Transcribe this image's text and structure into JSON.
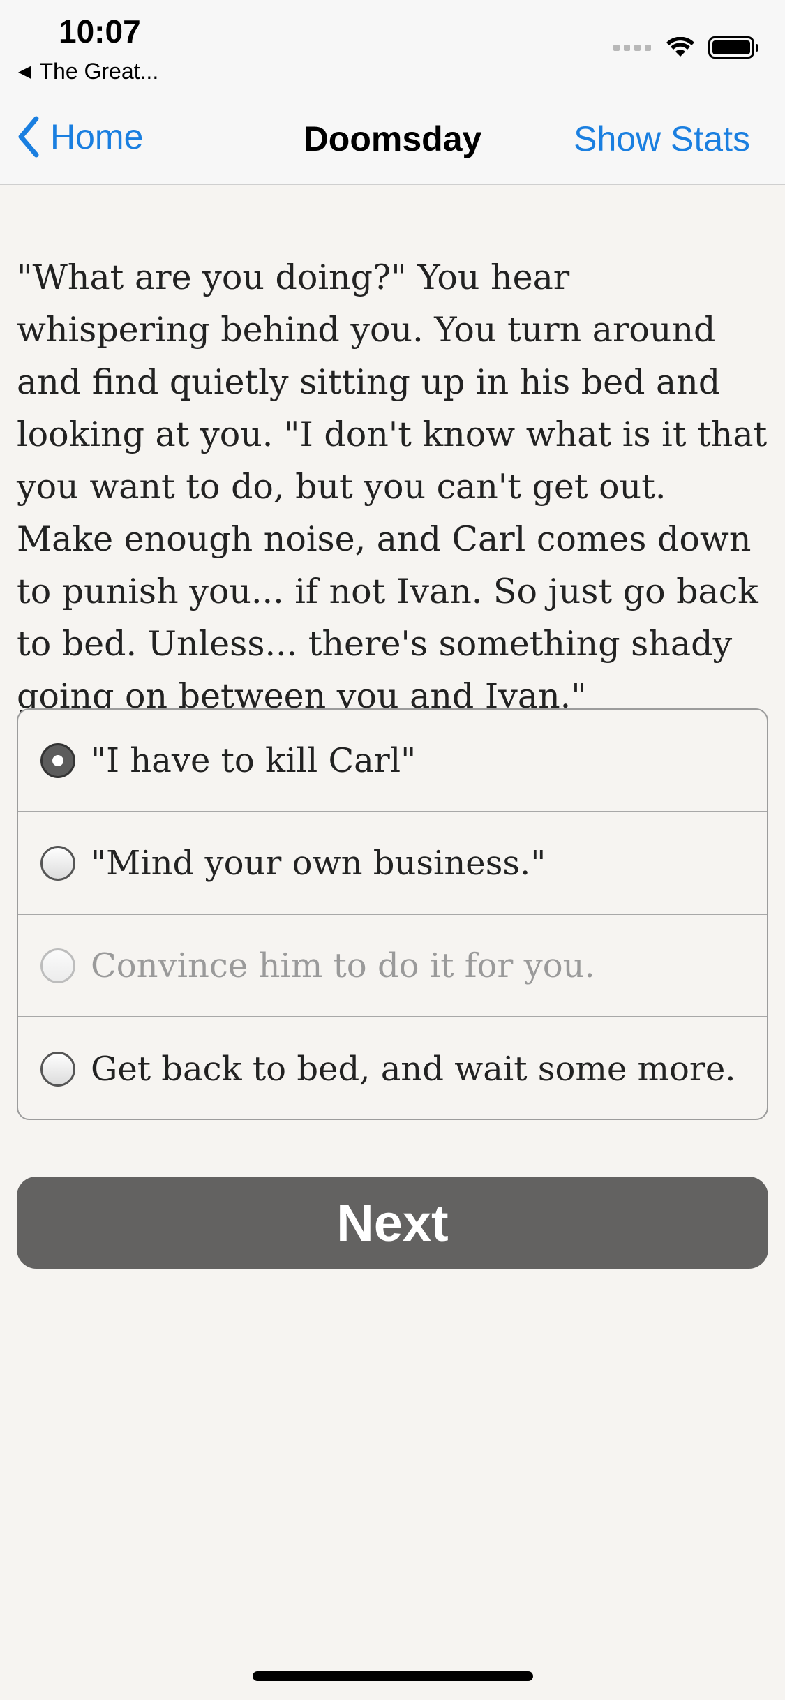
{
  "status_bar": {
    "time": "10:07",
    "back_app": "The Great...",
    "icons": [
      "cellular-signal-icon",
      "wifi-icon",
      "battery-icon"
    ]
  },
  "nav": {
    "back_label": "Home",
    "title": "Doomsday",
    "right_label": "Show Stats",
    "accent_color": "#1a7fe0"
  },
  "story": {
    "text": "\"What are you doing?\" You hear whispering behind you. You turn around and find quietly sitting up in his bed and looking at you. \"I don't know what is it that you want to do, but you can't get out. Make enough noise, and Carl comes down to punish you... if not Ivan. So just go back to bed. Unless... there's something shady going on between you and Ivan.\""
  },
  "options": [
    {
      "label": "\"I have to kill Carl\"",
      "selected": true,
      "disabled": false
    },
    {
      "label": "\"Mind your own business.\"",
      "selected": false,
      "disabled": false
    },
    {
      "label": "Convince him to do it for you.",
      "selected": false,
      "disabled": true
    },
    {
      "label": "Get back to bed, and wait some more.",
      "selected": false,
      "disabled": false
    }
  ],
  "next_button": {
    "label": "Next",
    "color": "#636261"
  }
}
